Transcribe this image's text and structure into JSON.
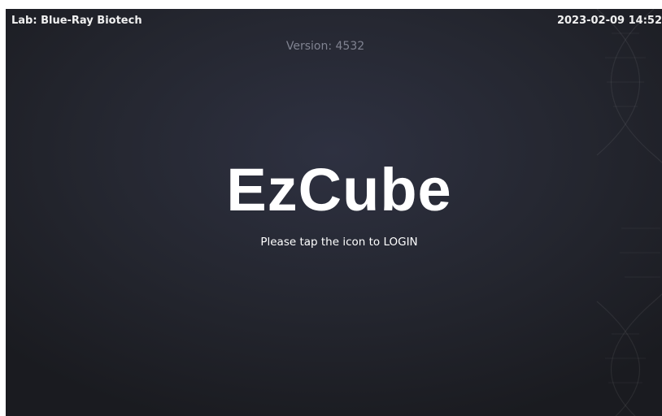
{
  "header": {
    "lab": "Lab: Blue-Ray Biotech",
    "datetime": "2023-02-09 14:52"
  },
  "version": "Version: 4532",
  "brand": "EzCube",
  "login_prompt": "Please tap the icon to LOGIN",
  "colors": {
    "background": "#24262f",
    "text": "#ffffff",
    "version_text": "#808391"
  },
  "icons": {
    "dna_decoration": "dna-helix-icon"
  }
}
